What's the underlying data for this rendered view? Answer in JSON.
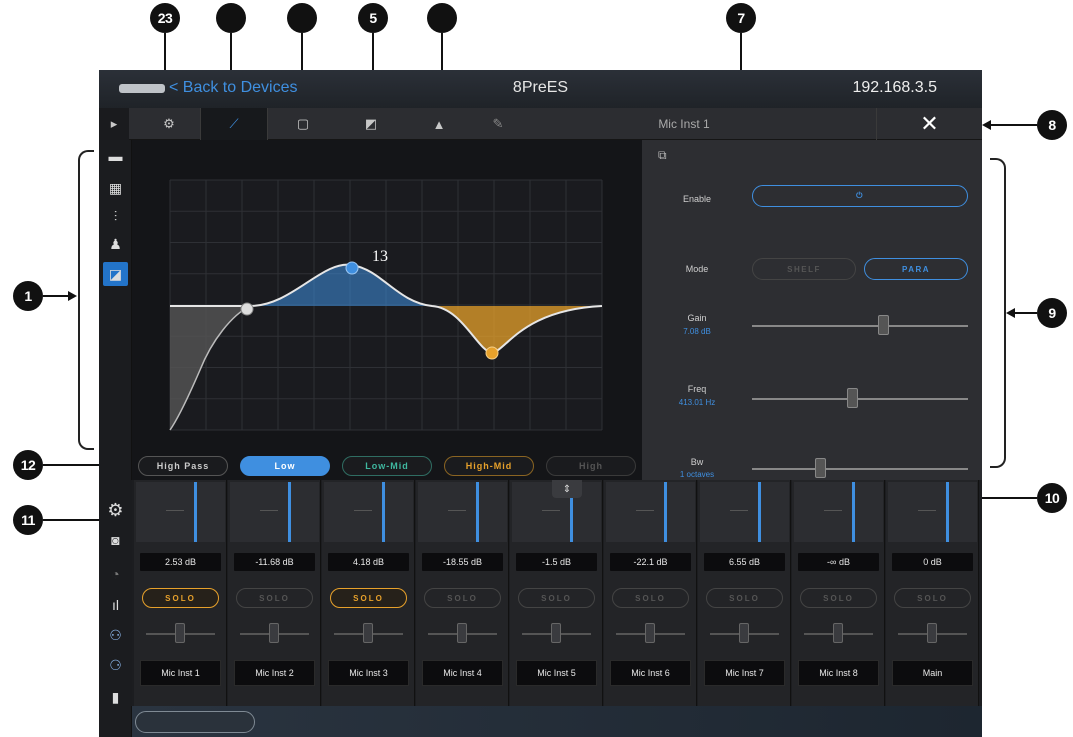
{
  "header": {
    "back_label": "< Back to Devices",
    "device_name": "8PreES",
    "ip_address": "192.168.3.5"
  },
  "toolbar": {
    "channel_title": "Mic Inst 1",
    "close_label": "✕",
    "icons": [
      "gear-icon",
      "eq-icon",
      "info-icon",
      "dynamics-icon",
      "room-eq-icon",
      "edit-icon"
    ]
  },
  "callouts": {
    "c1": "1",
    "c23": "23",
    "c5": "5",
    "c7": "7",
    "c8": "8",
    "c9": "9",
    "c10": "10",
    "c11": "11",
    "c12": "12",
    "c13": "13"
  },
  "eq": {
    "bands": {
      "high_pass": "High Pass",
      "low": "Low",
      "low_mid": "Low-Mid",
      "high_mid": "High-Mid",
      "high": "High"
    },
    "active_band": "Low",
    "colors": {
      "low": "#3f8fe0",
      "high_mid": "#e7a12b",
      "curve": "#e6e6e6"
    }
  },
  "params": {
    "enable_label": "Enable",
    "mode_label": "Mode",
    "gain_label": "Gain",
    "gain_value": "7.08 dB",
    "freq_label": "Freq",
    "freq_value": "413.01 Hz",
    "bw_label": "Bw",
    "bw_value": "1 octaves",
    "mode_option_a": "SHELF",
    "mode_option_b": "PARA",
    "mode_selected": "PARA",
    "gain_level": 0.6,
    "freq_level": 0.45,
    "bw_level": 0.3
  },
  "mixer": {
    "solo_label": "SOLO",
    "channels": [
      {
        "name": "Mic Inst 1",
        "level": "2.53 dB",
        "solo": true
      },
      {
        "name": "Mic Inst 2",
        "level": "-11.68 dB",
        "solo": false
      },
      {
        "name": "Mic Inst 3",
        "level": "4.18 dB",
        "solo": true
      },
      {
        "name": "Mic Inst 4",
        "level": "-18.55 dB",
        "solo": false
      },
      {
        "name": "Mic Inst 5",
        "level": "-1.5 dB",
        "solo": false
      },
      {
        "name": "Mic Inst 6",
        "level": "-22.1 dB",
        "solo": false
      },
      {
        "name": "Mic Inst 7",
        "level": "6.55 dB",
        "solo": false
      },
      {
        "name": "Mic Inst 8",
        "level": "-∞ dB",
        "solo": false
      },
      {
        "name": "Main",
        "level": "0 dB",
        "solo": false
      }
    ]
  }
}
